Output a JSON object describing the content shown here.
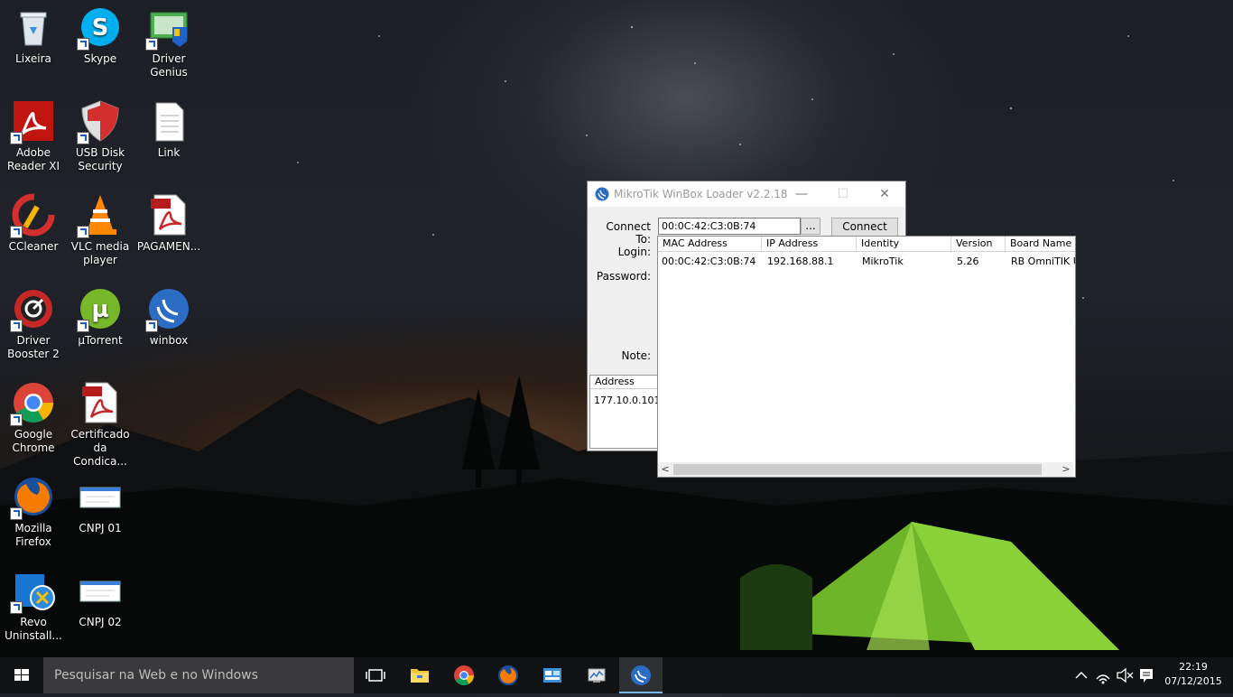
{
  "desktop": {
    "icons": [
      {
        "label": "Lixeira"
      },
      {
        "label": "Skype"
      },
      {
        "label": "Driver Genius"
      },
      {
        "label": "Adobe Reader XI"
      },
      {
        "label": "USB Disk Security"
      },
      {
        "label": "Link"
      },
      {
        "label": "CCleaner"
      },
      {
        "label": "VLC media player"
      },
      {
        "label": "PAGAMEN..."
      },
      {
        "label": "Driver Booster 2"
      },
      {
        "label": "µTorrent"
      },
      {
        "label": "winbox"
      },
      {
        "label": "Google Chrome"
      },
      {
        "label": "Certificado da Condica..."
      },
      {
        "label": "Mozilla Firefox"
      },
      {
        "label": "CNPJ 01"
      },
      {
        "label": "Revo Uninstall..."
      },
      {
        "label": "CNPJ 02"
      }
    ]
  },
  "window": {
    "title": "MikroTik WinBox Loader v2.2.18",
    "minimize": "—",
    "maximize": "☐",
    "close": "✕",
    "connect_to_label": "Connect To:",
    "connect_to_value": "00:0C:42:C3:0B:74",
    "browse_label": "...",
    "connect_label": "Connect",
    "login_label": "Login:",
    "password_label": "Password:",
    "note_label": "Note:",
    "address_header": "Address",
    "address_row": "177.10.0.101"
  },
  "device_list": {
    "columns": [
      "MAC Address",
      "IP Address",
      "Identity",
      "Version",
      "Board Name"
    ],
    "rows": [
      [
        "00:0C:42:C3:0B:74",
        "192.168.88.1",
        "MikroTik",
        "5.26",
        "RB OmniTIK U-"
      ]
    ],
    "scroll_left": "<",
    "scroll_right": ">"
  },
  "taskbar": {
    "search_placeholder": "Pesquisar na Web e no Windows",
    "time": "22:19",
    "date": "07/12/2015"
  }
}
